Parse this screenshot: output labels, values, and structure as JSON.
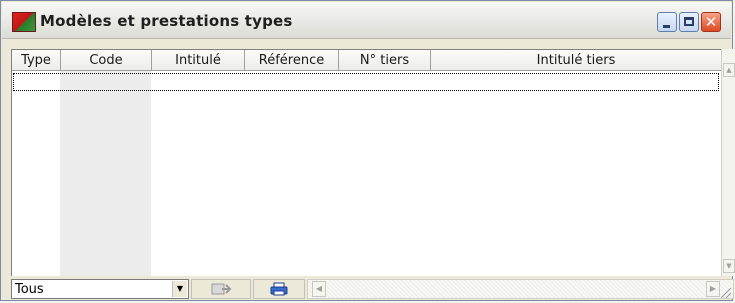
{
  "window": {
    "title": "Modèles et prestations types",
    "buttons": {
      "minimize": "minimize",
      "maximize": "maximize",
      "close": "✕"
    }
  },
  "grid": {
    "columns": [
      "Type",
      "Code",
      "Intitulé",
      "Référence",
      "N° tiers",
      "Intitulé tiers"
    ],
    "rows": []
  },
  "footer": {
    "filter_value": "Tous",
    "filter_options": [
      "Tous"
    ]
  },
  "icons": {
    "app": "app-flag-icon",
    "export": "export-icon",
    "print": "print-icon"
  }
}
